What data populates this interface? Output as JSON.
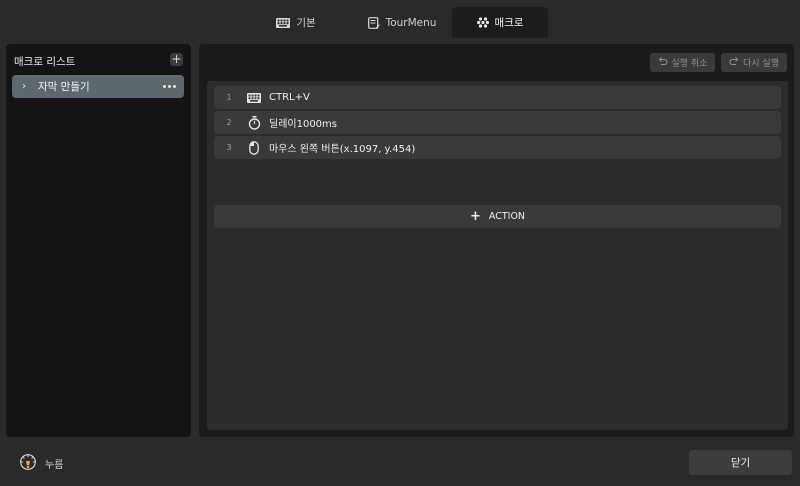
{
  "tabs": [
    {
      "label": "기본",
      "icon": "keyboard-icon"
    },
    {
      "label": "TourMenu",
      "icon": "menu-edit-icon"
    },
    {
      "label": "매크로",
      "icon": "macro-dots-icon"
    }
  ],
  "active_tab": "매크로",
  "left": {
    "title": "매크로 리스트",
    "add_label": "+",
    "items": [
      {
        "chevron": "›",
        "label": "자막 만들기"
      }
    ]
  },
  "toolbar": {
    "undo_label": "실행 취소",
    "redo_label": "다시 실행"
  },
  "actions": [
    {
      "index": "1",
      "icon": "keyboard-icon",
      "text": "CTRL+V"
    },
    {
      "index": "2",
      "icon": "stopwatch-icon",
      "text": "딜레이1000ms"
    },
    {
      "index": "3",
      "icon": "mouse-icon",
      "text": "마우스 왼쪽 버튼(x.1097, y.454)"
    }
  ],
  "add_action": {
    "plus": "+",
    "label": "ACTION"
  },
  "footer": {
    "brand_label": "누름",
    "close_label": "닫기"
  },
  "colors": {
    "background": "#2a2a2a",
    "panel": "#141414",
    "selected_item": "#5d676e",
    "row": "#3a3a3a"
  }
}
